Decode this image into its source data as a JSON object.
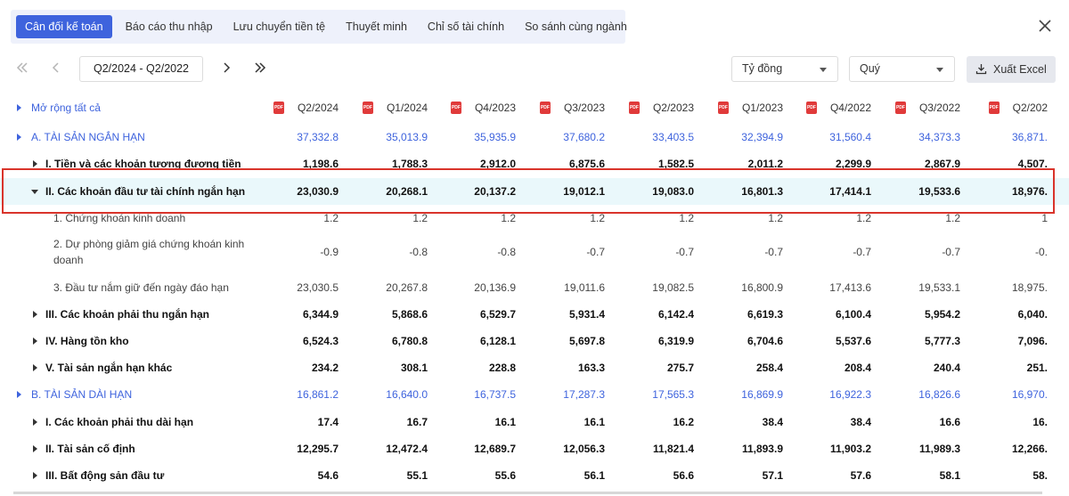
{
  "tabs": [
    "Cân đối kế toán",
    "Báo cáo thu nhập",
    "Lưu chuyển tiền tệ",
    "Thuyết minh",
    "Chỉ số tài chính",
    "So sánh cùng ngành"
  ],
  "period_range": "Q2/2024 - Q2/2022",
  "unit_select": "Tỷ đồng",
  "period_type_select": "Quý",
  "export_label": "Xuất Excel",
  "expand_all": "Mở rộng tất cả",
  "columns": [
    "Q2/2024",
    "Q1/2024",
    "Q4/2023",
    "Q3/2023",
    "Q2/2023",
    "Q1/2023",
    "Q4/2022",
    "Q3/2022",
    "Q2/202"
  ],
  "pdf_icon_text": "PDF",
  "rows": [
    {
      "label": "A. TÀI SẢN NGẮN HẠN",
      "values": [
        "37,332.8",
        "35,013.9",
        "35,935.9",
        "37,680.2",
        "33,403.5",
        "32,394.9",
        "31,560.4",
        "34,373.3",
        "36,871."
      ]
    },
    {
      "label": "I. Tiền và các khoản tương đương tiền",
      "values": [
        "1,198.6",
        "1,788.3",
        "2,912.0",
        "6,875.6",
        "1,582.5",
        "2,011.2",
        "2,299.9",
        "2,867.9",
        "4,507."
      ]
    },
    {
      "label": "II. Các khoản đầu tư tài chính ngắn hạn",
      "values": [
        "23,030.9",
        "20,268.1",
        "20,137.2",
        "19,012.1",
        "19,083.0",
        "16,801.3",
        "17,414.1",
        "19,533.6",
        "18,976."
      ]
    },
    {
      "label": "1. Chứng khoán kinh doanh",
      "values": [
        "1.2",
        "1.2",
        "1.2",
        "1.2",
        "1.2",
        "1.2",
        "1.2",
        "1.2",
        "1"
      ]
    },
    {
      "label": "2. Dự phòng giảm giá chứng khoán kinh doanh",
      "values": [
        "-0.9",
        "-0.8",
        "-0.8",
        "-0.7",
        "-0.7",
        "-0.7",
        "-0.7",
        "-0.7",
        "-0."
      ]
    },
    {
      "label": "3. Đầu tư nắm giữ đến ngày đáo hạn",
      "values": [
        "23,030.5",
        "20,267.8",
        "20,136.9",
        "19,011.6",
        "19,082.5",
        "16,800.9",
        "17,413.6",
        "19,533.1",
        "18,975."
      ]
    },
    {
      "label": "III. Các khoản phải thu ngắn hạn",
      "values": [
        "6,344.9",
        "5,868.6",
        "6,529.7",
        "5,931.4",
        "6,142.4",
        "6,619.3",
        "6,100.4",
        "5,954.2",
        "6,040."
      ]
    },
    {
      "label": "IV. Hàng tồn kho",
      "values": [
        "6,524.3",
        "6,780.8",
        "6,128.1",
        "5,697.8",
        "6,319.9",
        "6,704.6",
        "5,537.6",
        "5,777.3",
        "7,096."
      ]
    },
    {
      "label": "V. Tài sản ngắn hạn khác",
      "values": [
        "234.2",
        "308.1",
        "228.8",
        "163.3",
        "275.7",
        "258.4",
        "208.4",
        "240.4",
        "251."
      ]
    },
    {
      "label": "B. TÀI SẢN DÀI HẠN",
      "values": [
        "16,861.2",
        "16,640.0",
        "16,737.5",
        "17,287.3",
        "17,565.3",
        "16,869.9",
        "16,922.3",
        "16,826.6",
        "16,970."
      ]
    },
    {
      "label": "I. Các khoản phải thu dài hạn",
      "values": [
        "17.4",
        "16.7",
        "16.1",
        "16.1",
        "16.2",
        "38.4",
        "38.4",
        "16.6",
        "16."
      ]
    },
    {
      "label": "II. Tài sản cố định",
      "values": [
        "12,295.7",
        "12,472.4",
        "12,689.7",
        "12,056.3",
        "11,821.4",
        "11,893.9",
        "11,903.2",
        "11,989.3",
        "12,266."
      ]
    },
    {
      "label": "III. Bất động sản đầu tư",
      "values": [
        "54.6",
        "55.1",
        "55.6",
        "56.1",
        "56.6",
        "57.1",
        "57.6",
        "58.1",
        "58."
      ]
    }
  ]
}
